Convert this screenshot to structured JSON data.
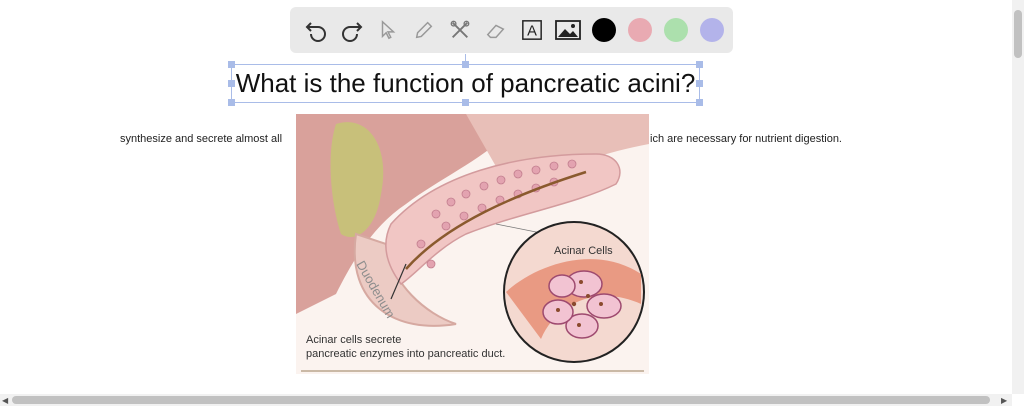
{
  "toolbar": {
    "tools": [
      "undo-icon",
      "redo-icon",
      "pointer-icon",
      "pencil-icon",
      "tools-icon",
      "eraser-icon",
      "text-icon",
      "image-icon"
    ],
    "text_tool_glyph": "A",
    "colors": [
      "#000000",
      "#e9aab2",
      "#ace0ad",
      "#b3b3ea"
    ]
  },
  "title": "What is the function of pancreatic acini?",
  "answer": {
    "left": "synthesize and secrete almost all",
    "right": "ich are necessary for nutrient digestion."
  },
  "illustration": {
    "label_acinar": "Acinar Cells",
    "label_duodenum": "Duodenum",
    "caption_line1": "Acinar cells secrete",
    "caption_line2": "pancreatic enzymes into pancreatic duct."
  }
}
